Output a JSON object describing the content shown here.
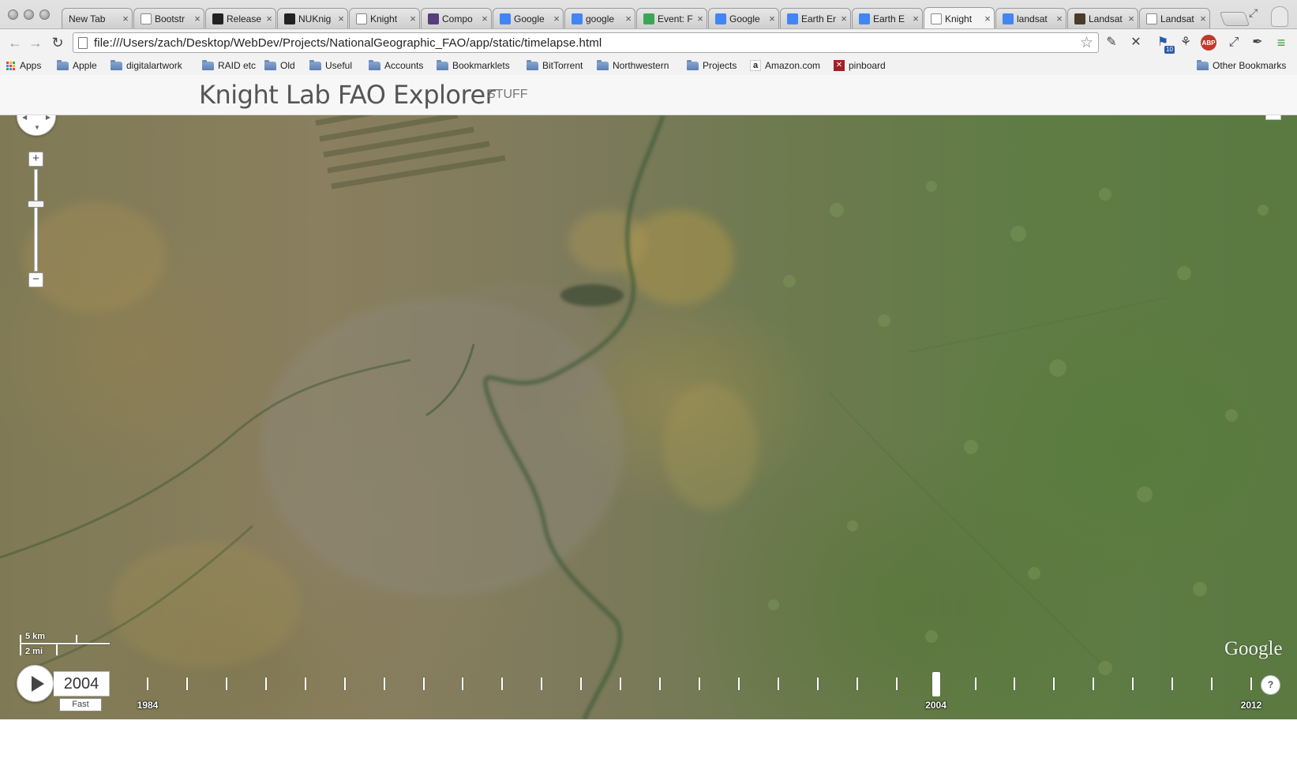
{
  "browser": {
    "tabs": [
      {
        "label": "New Tab",
        "icon": "none",
        "color": "#ffffff"
      },
      {
        "label": "Bootstr",
        "icon": "page-icon",
        "color": "#ffffff"
      },
      {
        "label": "Release",
        "icon": "github-icon",
        "color": "#222222"
      },
      {
        "label": "NUKnig",
        "icon": "github-icon",
        "color": "#222222"
      },
      {
        "label": "Knight",
        "icon": "page-icon",
        "color": "#ffffff"
      },
      {
        "label": "Compo",
        "icon": "bootstrap-icon",
        "color": "#563d7c"
      },
      {
        "label": "Google",
        "icon": "google-icon",
        "color": "#4285f4"
      },
      {
        "label": "google",
        "icon": "google-search-icon",
        "color": "#4285f4"
      },
      {
        "label": "Event: F",
        "icon": "cloud-icon",
        "color": "#3aa757"
      },
      {
        "label": "Google",
        "icon": "google-icon",
        "color": "#4285f4"
      },
      {
        "label": "Earth Er",
        "icon": "docs-icon",
        "color": "#4285f4"
      },
      {
        "label": "Earth E",
        "icon": "google-search-icon",
        "color": "#4285f4"
      },
      {
        "label": "Knight",
        "icon": "page-icon",
        "color": "#ffffff",
        "active": true
      },
      {
        "label": "landsat",
        "icon": "google-search-icon",
        "color": "#4285f4"
      },
      {
        "label": "Landsat",
        "icon": "landsat-icon",
        "color": "#4a3b2a"
      },
      {
        "label": "Landsat",
        "icon": "page-icon",
        "color": "#ffffff"
      }
    ],
    "tab_close": "×",
    "url": "file:///Users/zach/Desktop/WebDev/Projects/NationalGeographic_FAO/app/static/timelapse.html",
    "extension_badge": "10",
    "abp_label": "ABP",
    "bookmarks": [
      {
        "label": "Apps",
        "kind": "apps"
      },
      {
        "label": "Apple",
        "kind": "folder"
      },
      {
        "label": "digitalartwork",
        "kind": "folder"
      },
      {
        "label": "RAID etc",
        "kind": "folder"
      },
      {
        "label": "Old",
        "kind": "folder"
      },
      {
        "label": "Useful",
        "kind": "folder"
      },
      {
        "label": "Accounts",
        "kind": "folder"
      },
      {
        "label": "Bookmarklets",
        "kind": "folder"
      },
      {
        "label": "BitTorrent",
        "kind": "folder"
      },
      {
        "label": "Northwestern",
        "kind": "folder"
      },
      {
        "label": "Projects",
        "kind": "folder"
      },
      {
        "label": "Amazon.com",
        "kind": "amazon"
      },
      {
        "label": "pinboard",
        "kind": "pinboard"
      }
    ],
    "other_bookmarks": "Other Bookmarks"
  },
  "app": {
    "title": "Knight Lab FAO Explorer",
    "subtitle": "STUFF"
  },
  "map": {
    "zoom_in_label": "+",
    "zoom_out_label": "−",
    "zoom_level_fraction": 0.4,
    "scale_km": "5 km",
    "scale_mi": "2 mi",
    "attribution": "Google"
  },
  "timelapse": {
    "play_state": "paused",
    "current_year": "2004",
    "speed_label": "Fast",
    "start_year": "1984",
    "end_year": "2012",
    "tick_years": [
      1984,
      1985,
      1986,
      1987,
      1988,
      1989,
      1990,
      1991,
      1992,
      1993,
      1994,
      1995,
      1996,
      1997,
      1998,
      1999,
      2000,
      2001,
      2002,
      2003,
      2004,
      2005,
      2006,
      2007,
      2008,
      2009,
      2010,
      2011,
      2012
    ],
    "labeled_years": [
      "1984",
      "2004",
      "2012"
    ],
    "help_label": "?"
  }
}
